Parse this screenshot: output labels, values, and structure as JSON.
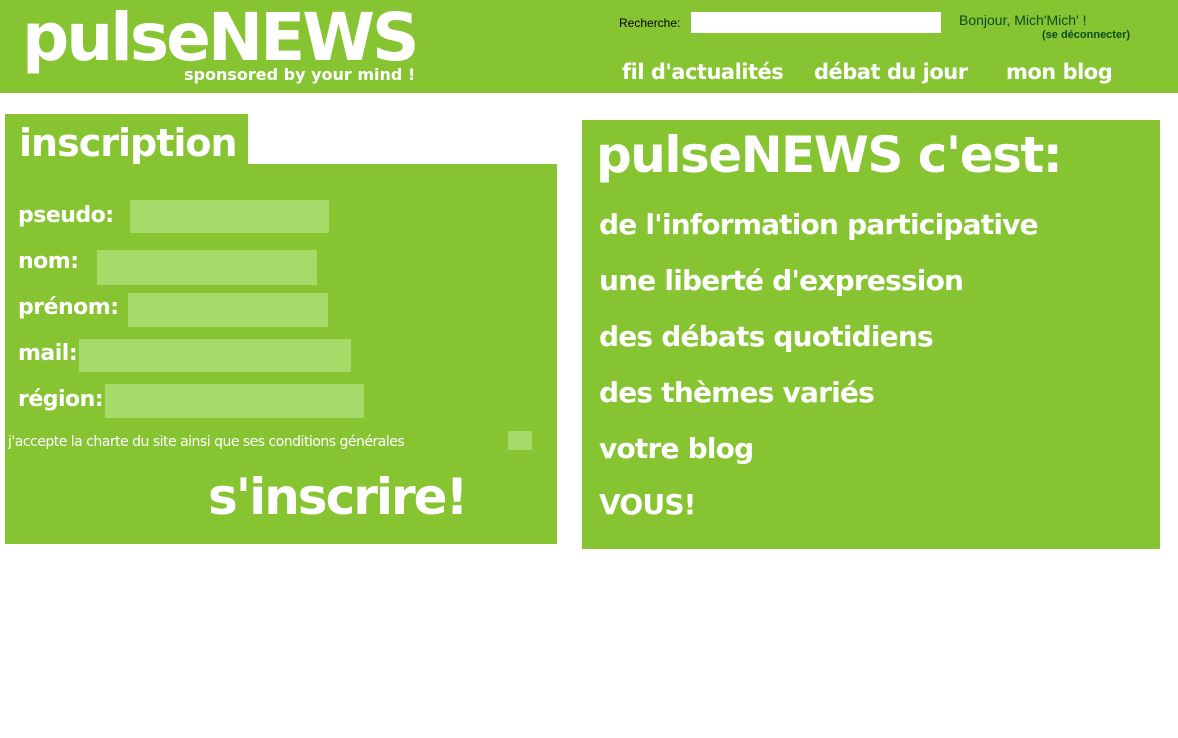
{
  "header": {
    "logo": "pulseNEWS",
    "tagline": "sponsored by your mind !",
    "search_label": "Recherche:",
    "search_value": "",
    "greeting": "Bonjour, Mich'Mich' !",
    "logout": "(se déconnecter)",
    "nav": [
      "fil d'actualités",
      "débat du jour",
      "mon blog"
    ]
  },
  "inscription": {
    "title": "inscription",
    "fields": [
      {
        "label": "pseudo:",
        "value": ""
      },
      {
        "label": "nom:",
        "value": ""
      },
      {
        "label": "prénom:",
        "value": ""
      },
      {
        "label": "mail:",
        "value": ""
      },
      {
        "label": "région:",
        "value": ""
      }
    ],
    "charter": "j'accepte la charte du site ainsi que ses conditions générales",
    "submit": "s'inscrire!"
  },
  "about": {
    "title": "pulseNEWS c'est:",
    "items": [
      "de l'information participative",
      "une liberté d'expression",
      "des débats quotidiens",
      "des thèmes variés",
      "votre blog",
      "VOUS!"
    ]
  },
  "colors": {
    "brand_green": "#86c432",
    "input_green": "#a6da69",
    "greeting_text": "#0b4b1c"
  }
}
